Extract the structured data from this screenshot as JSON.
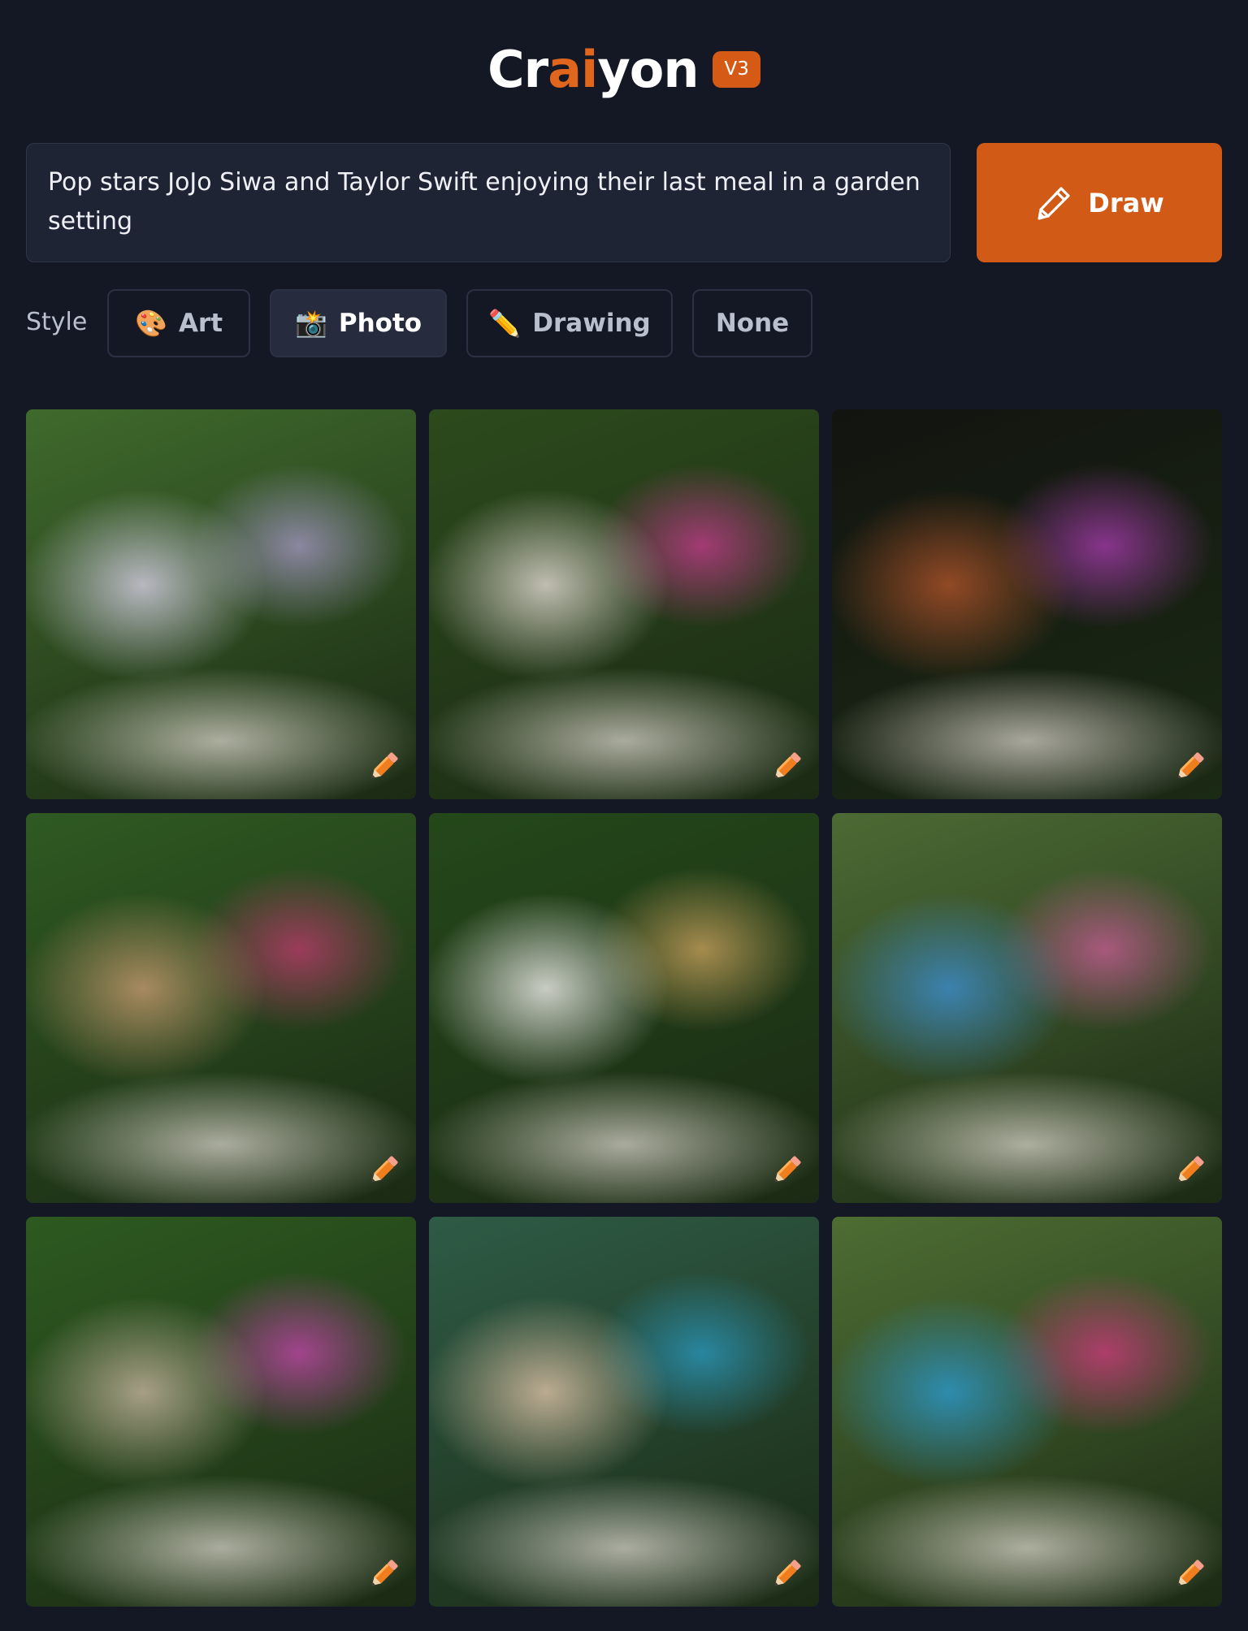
{
  "header": {
    "logo_parts": [
      "Cr",
      "ai",
      "yon"
    ],
    "version": "V3"
  },
  "prompt": {
    "text": "Pop stars JoJo Siwa and Taylor Swift enjoying their last meal in a garden setting"
  },
  "draw_button": {
    "label": "Draw",
    "icon": "pencil-icon"
  },
  "style": {
    "label": "Style",
    "options": [
      {
        "label": "Art",
        "icon": "palette-icon",
        "emoji": "🎨",
        "active": false
      },
      {
        "label": "Photo",
        "icon": "camera-flash-icon",
        "emoji": "📸",
        "active": true
      },
      {
        "label": "Drawing",
        "icon": "pencil-icon",
        "emoji": "✏️",
        "active": false
      },
      {
        "label": "None",
        "icon": "",
        "emoji": "",
        "active": false
      }
    ]
  },
  "images": {
    "count": 9,
    "edit_icon": "edit-pencil-icon",
    "palettes": [
      {
        "bg": "#3f6a2c",
        "accent": "#b8a3e0",
        "mid": "#d9d2e8"
      },
      {
        "bg": "#2c4a1c",
        "accent": "#e03aa0",
        "mid": "#e6ddd6"
      },
      {
        "bg": "#121410",
        "accent": "#c040c8",
        "mid": "#b0542a"
      },
      {
        "bg": "#2f5a22",
        "accent": "#d6387a",
        "mid": "#c89b70"
      },
      {
        "bg": "#24481a",
        "accent": "#e8b46a",
        "mid": "#f2f0ee"
      },
      {
        "bg": "#4c6a34",
        "accent": "#e05ea8",
        "mid": "#3c8ed0"
      },
      {
        "bg": "#2d5a20",
        "accent": "#e043c4",
        "mid": "#c7b5a0"
      },
      {
        "bg": "#2e5b46",
        "accent": "#2aa6d6",
        "mid": "#e0c4a8"
      },
      {
        "bg": "#4d6d33",
        "accent": "#e8348c",
        "mid": "#2a9ad0"
      }
    ]
  },
  "colors": {
    "background": "#141824",
    "accent": "#d25a17",
    "input_bg": "#1f2434"
  }
}
